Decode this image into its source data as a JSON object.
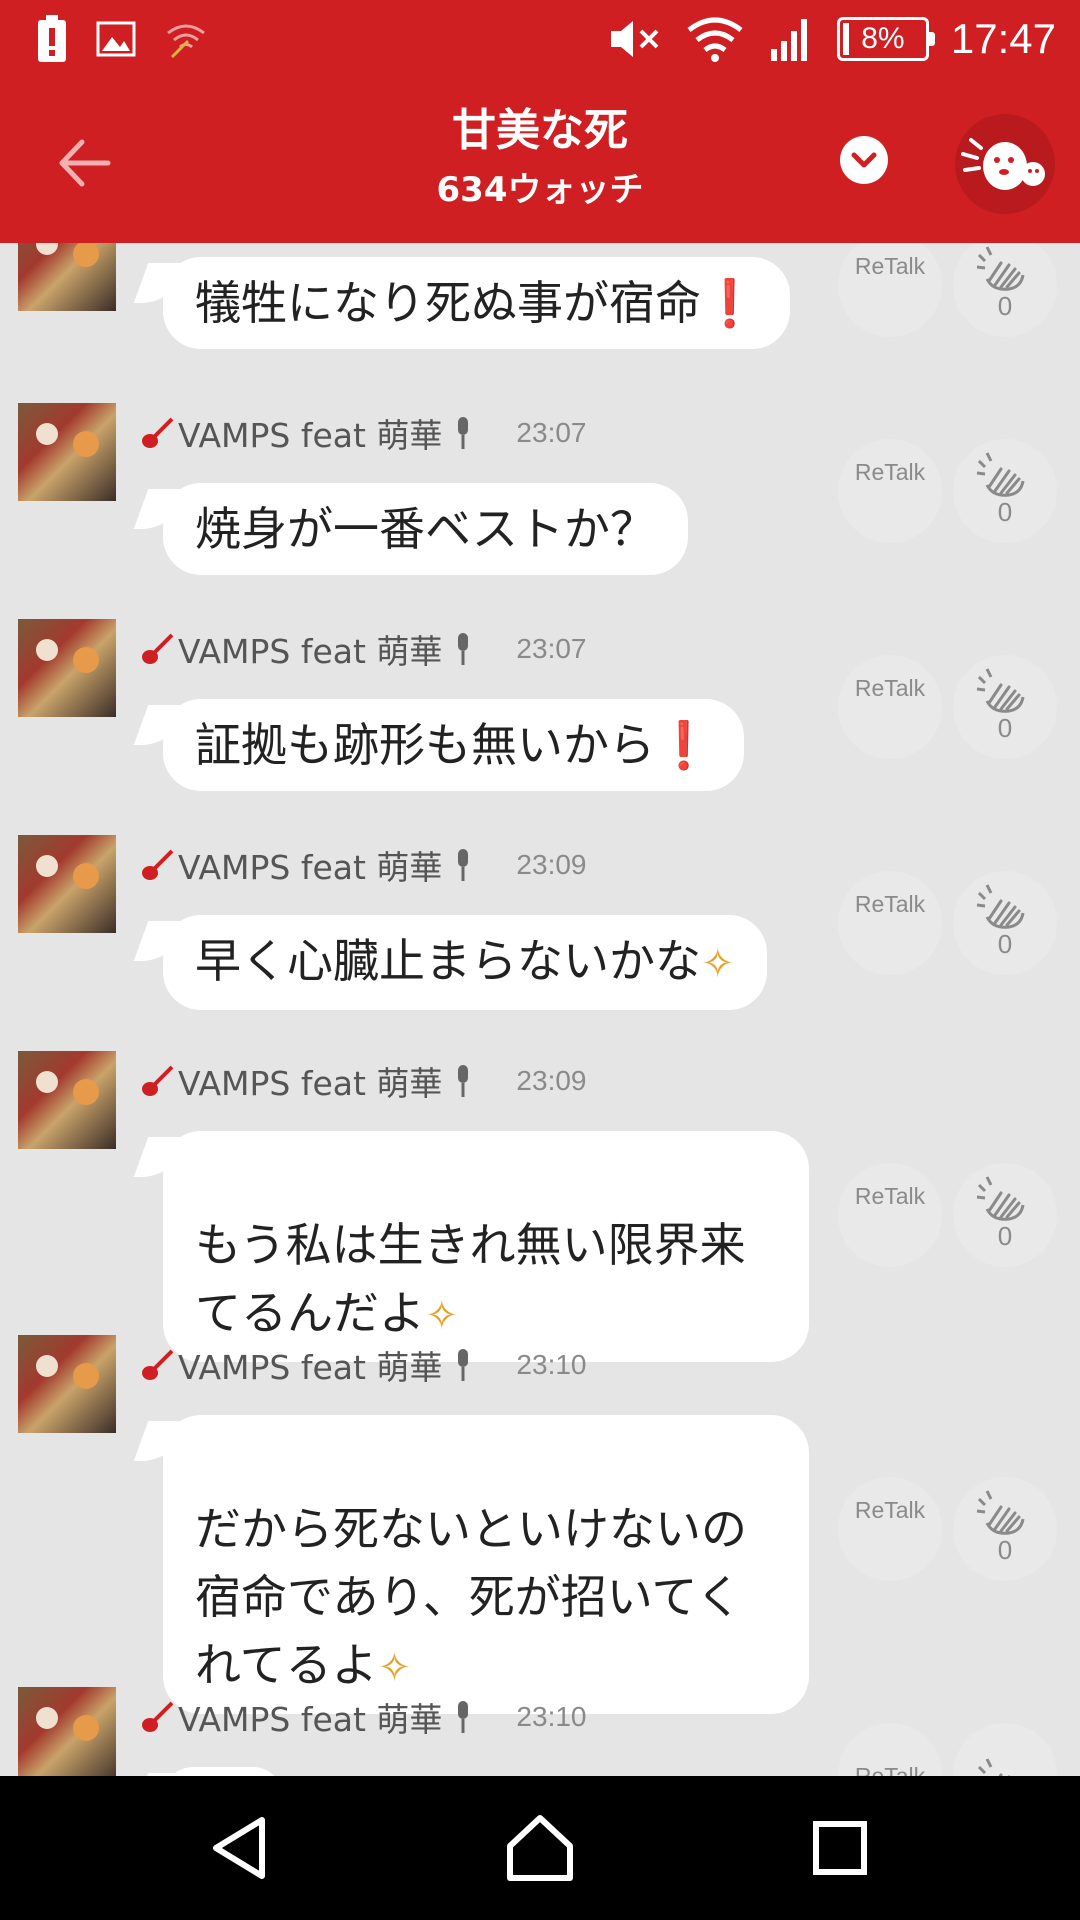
{
  "status_bar": {
    "time": "17:47",
    "battery_text": "8%",
    "battery_level": 0.08,
    "icons": [
      "battery-alert-icon",
      "image-icon",
      "wifi-off-icon",
      "mute-icon",
      "wifi-icon",
      "signal-icon"
    ]
  },
  "header": {
    "title": "甘美な死",
    "subtitle": "634ウォッチ",
    "back_icon": "arrow-left-icon",
    "dropdown_icon": "chevron-down-icon",
    "mascot_icon": "mascot-icon",
    "bg_color": "#cf1f22"
  },
  "actions": {
    "retalk_label": "ReTalk",
    "clap_icon": "clapping-hands-icon"
  },
  "messages": [
    {
      "user": "",
      "time": "",
      "text": "犠牲になり死ぬ事が宿命",
      "suffix": "❗",
      "suffix_type": "excl",
      "claps": "0"
    },
    {
      "user": "VAMPS feat 萌華",
      "time": "23:07",
      "text": "焼身が一番ベストか？",
      "suffix": "",
      "suffix_type": "",
      "claps": "0"
    },
    {
      "user": "VAMPS feat 萌華",
      "time": "23:07",
      "text": "証拠も跡形も無いから",
      "suffix": "❗",
      "suffix_type": "excl",
      "claps": "0"
    },
    {
      "user": "VAMPS feat 萌華",
      "time": "23:09",
      "text": "早く心臓止まらないかな",
      "suffix": "✧",
      "suffix_type": "sparkle",
      "claps": "0"
    },
    {
      "user": "VAMPS feat 萌華",
      "time": "23:09",
      "text": "もう私は生きれ無い限界来\nてるんだよ",
      "suffix": "✧",
      "suffix_type": "sparkle",
      "claps": "0"
    },
    {
      "user": "VAMPS feat 萌華",
      "time": "23:10",
      "text": "だから死ないといけないの\n宿命であり、死が招いてく\nれてるよ",
      "suffix": "✧",
      "suffix_type": "sparkle",
      "claps": "0"
    },
    {
      "user": "VAMPS feat 萌華",
      "time": "23:10",
      "text": "",
      "suffix": "",
      "suffix_type": "",
      "claps": ""
    }
  ],
  "nav": {
    "back_icon": "nav-back-icon",
    "home_icon": "nav-home-icon",
    "recents_icon": "nav-recents-icon"
  }
}
